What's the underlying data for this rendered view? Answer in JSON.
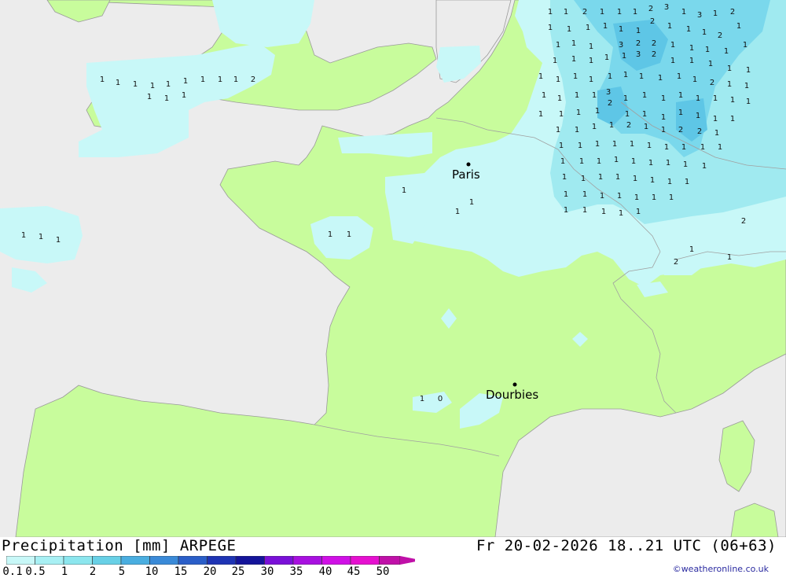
{
  "product": "Precipitation [mm] ARPEGE",
  "valid_time": "Fr 20-02-2026 18..21 UTC (06+63)",
  "credit": "©weatheronline.co.uk",
  "cities": [
    {
      "name": "Paris"
    },
    {
      "name": "Dourbies"
    }
  ],
  "legend": {
    "labels": [
      "0.1",
      "0.5",
      "1",
      "2",
      "5",
      "10",
      "15",
      "20",
      "25",
      "30",
      "35",
      "40",
      "45",
      "50"
    ],
    "colors": [
      "#c8f8f8",
      "#a8f0f4",
      "#8ce6ee",
      "#68d0e6",
      "#4aaee0",
      "#3a8ad8",
      "#2a5ec8",
      "#1e34b4",
      "#14149a",
      "#7a10d8",
      "#a810e0",
      "#d010e6",
      "#e610d0",
      "#c010a8"
    ]
  },
  "colors": {
    "sea": "#ececec",
    "land": "#c8fc9c",
    "precip_light": "#c8f8f8",
    "precip_mid": "#a0eaf0",
    "precip_heavy": "#7ad8ec",
    "border": "#a0a0a0"
  }
}
